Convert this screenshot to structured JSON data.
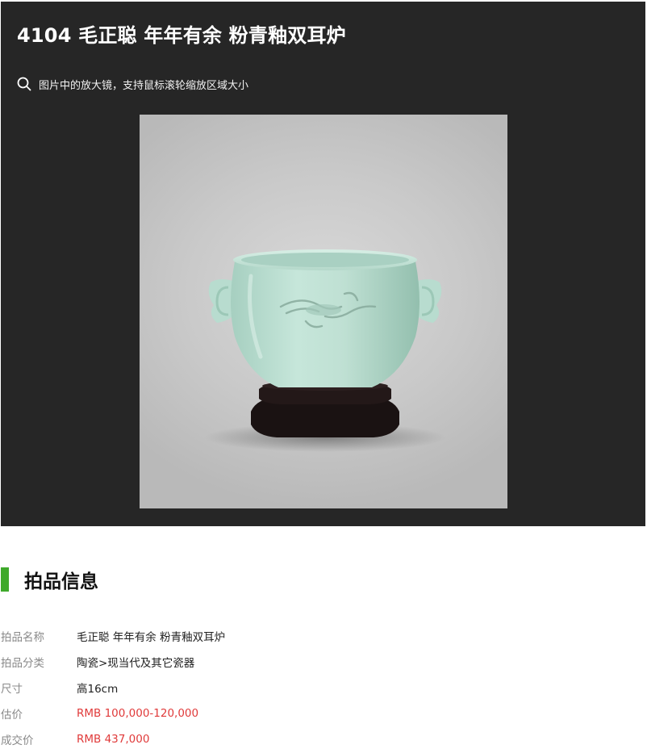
{
  "lot": {
    "title": "4104 毛正聪 年年有余 粉青釉双耳炉",
    "zoom_hint": "图片中的放大镜，支持鼠标滚轮缩放区域大小",
    "image_alt": "毛正聪 年年有余 粉青釉双耳炉"
  },
  "section": {
    "title": "拍品信息",
    "accent_color": "#3fa92b"
  },
  "info_rows": [
    {
      "label": "拍品名称",
      "value": "毛正聪 年年有余 粉青釉双耳炉"
    },
    {
      "label": "拍品分类",
      "value": "陶瓷>现当代及其它瓷器"
    },
    {
      "label": "尺寸",
      "value": "高16cm"
    },
    {
      "label": "估价",
      "value": "RMB 100,000-120,000"
    },
    {
      "label": "成交价",
      "value": "RMB 437,000"
    }
  ],
  "icons": {
    "zoom": "magnifier-icon"
  },
  "colors": {
    "panel_bg": "#262626",
    "price_red": "#e03a3a",
    "label_gray": "#8a8a8a"
  }
}
